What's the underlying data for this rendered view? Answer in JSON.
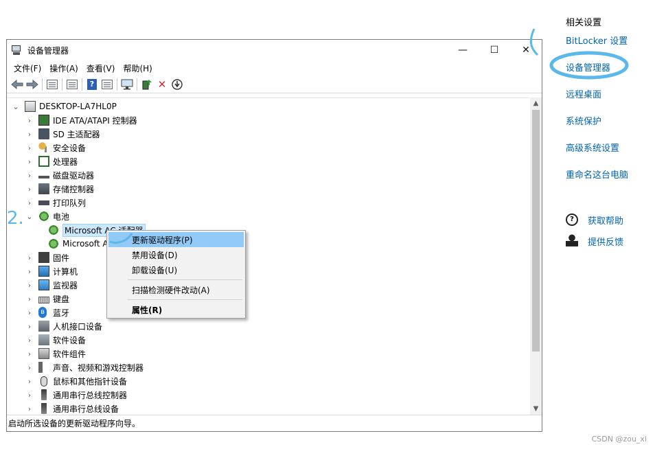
{
  "window": {
    "title": "设备管理器",
    "controls": {
      "minimize": "—",
      "maximize": "☐",
      "close": "✕"
    }
  },
  "menubar": [
    "文件(F)",
    "操作(A)",
    "查看(V)",
    "帮助(H)"
  ],
  "toolbar_icons": [
    "back-arrow-icon",
    "forward-arrow-icon",
    "console-tree-icon",
    "properties-icon",
    "help-icon",
    "action-pane-icon",
    "monitor-icon",
    "update-driver-icon",
    "uninstall-icon",
    "download-icon"
  ],
  "tree": {
    "root": "DESKTOP-LA7HL0P",
    "items": [
      {
        "label": "IDE ATA/ATAPI 控制器",
        "icon": "ide-controller-icon",
        "expanded": false
      },
      {
        "label": "SD 主适配器",
        "icon": "sd-host-icon",
        "expanded": false
      },
      {
        "label": "安全设备",
        "icon": "security-device-icon",
        "expanded": false
      },
      {
        "label": "处理器",
        "icon": "processor-icon",
        "expanded": false
      },
      {
        "label": "磁盘驱动器",
        "icon": "disk-drive-icon",
        "expanded": false
      },
      {
        "label": "存储控制器",
        "icon": "storage-controller-icon",
        "expanded": false
      },
      {
        "label": "打印队列",
        "icon": "printer-icon",
        "expanded": false
      },
      {
        "label": "电池",
        "icon": "battery-icon",
        "expanded": true,
        "children": [
          "Microsoft AC 适配器",
          "Microsoft A"
        ]
      },
      {
        "label": "固件",
        "icon": "firmware-icon",
        "expanded": false
      },
      {
        "label": "计算机",
        "icon": "computer-icon",
        "expanded": false
      },
      {
        "label": "监视器",
        "icon": "monitor-icon",
        "expanded": false
      },
      {
        "label": "键盘",
        "icon": "keyboard-icon",
        "expanded": false
      },
      {
        "label": "蓝牙",
        "icon": "bluetooth-icon",
        "expanded": false
      },
      {
        "label": "人机接口设备",
        "icon": "hid-icon",
        "expanded": false
      },
      {
        "label": "软件设备",
        "icon": "software-device-icon",
        "expanded": false
      },
      {
        "label": "软件组件",
        "icon": "software-component-icon",
        "expanded": false
      },
      {
        "label": "声音、视频和游戏控制器",
        "icon": "audio-icon",
        "expanded": false
      },
      {
        "label": "鼠标和其他指针设备",
        "icon": "mouse-icon",
        "expanded": false
      },
      {
        "label": "通用串行总线控制器",
        "icon": "usb-icon",
        "expanded": false
      },
      {
        "label": "通用串行总线设备",
        "icon": "usb-icon",
        "expanded": false
      }
    ]
  },
  "context_menu": {
    "items": [
      "更新驱动程序(P)",
      "禁用设备(D)",
      "卸载设备(U)",
      "扫描检测硬件改动(A)",
      "属性(R)"
    ]
  },
  "statusbar": "启动所选设备的更新驱动程序向导。",
  "side_panel": {
    "title": "相关设置",
    "links": [
      "BitLocker 设置",
      "设备管理器",
      "远程桌面",
      "系统保护",
      "高级系统设置",
      "重命名这台电脑"
    ],
    "help": "获取帮助",
    "feedback": "提供反馈"
  },
  "annotations": {
    "step2": "2."
  },
  "watermark": "CSDN @zou_xi",
  "colors": {
    "link": "#0063b1",
    "highlight_stroke": "#5bb8ea",
    "menu_hover": "#91c9f7"
  }
}
